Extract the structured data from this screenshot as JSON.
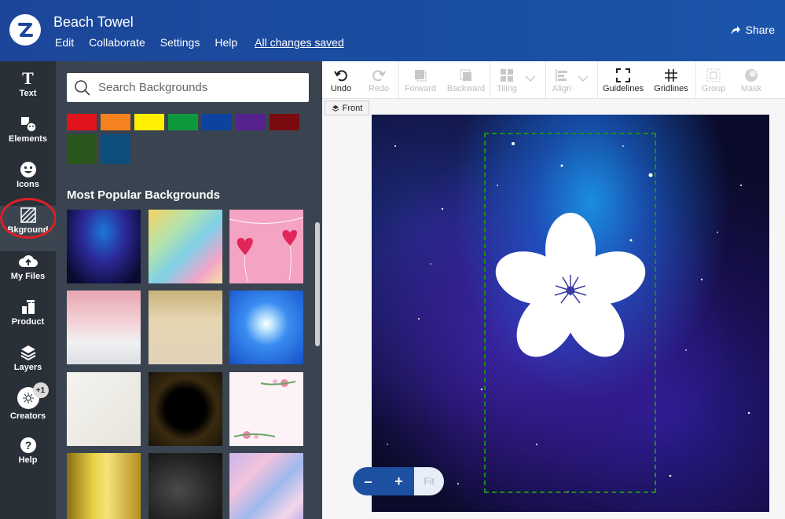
{
  "header": {
    "title": "Beach Towel",
    "menu": [
      "Edit",
      "Collaborate",
      "Settings",
      "Help"
    ],
    "saved_status": "All changes saved",
    "share_label": "Share",
    "logo_icon": "zazzle-logo-icon"
  },
  "rail": [
    {
      "label": "Text",
      "icon": "text-icon"
    },
    {
      "label": "Elements",
      "icon": "elements-icon"
    },
    {
      "label": "Icons",
      "icon": "smiley-icon"
    },
    {
      "label": "Bkground",
      "icon": "background-icon"
    },
    {
      "label": "My Files",
      "icon": "cloud-upload-icon"
    },
    {
      "label": "Product",
      "icon": "product-icon"
    },
    {
      "label": "Layers",
      "icon": "layers-icon"
    },
    {
      "label": "Creators",
      "icon": "creators-icon",
      "badge": "+1"
    },
    {
      "label": "Help",
      "icon": "help-icon"
    }
  ],
  "panel": {
    "search_placeholder": "Search Backgrounds",
    "swatch_colors": [
      "#e3131e",
      "#f5821f",
      "#ffef00",
      "#0e9a3c",
      "#0d43a0",
      "#55228e",
      "#7a0a10",
      "#2b571d",
      "#0c4e7d"
    ],
    "section_title": "Most Popular Backgrounds",
    "thumbnails": [
      "galaxy",
      "watercolor",
      "pink-hearts",
      "pink-glitter",
      "gold-drip",
      "blue-burst",
      "white-paper",
      "gold-sparkle-frame",
      "floral-frame",
      "gold-gradient",
      "black-marble",
      "pastel-swirl"
    ]
  },
  "toolbar": {
    "undo": "Undo",
    "redo": "Redo",
    "forward": "Forward",
    "backward": "Backward",
    "tiling": "Tiling",
    "align": "Align",
    "guidelines": "Guidelines",
    "gridlines": "Gridlines",
    "group": "Group",
    "mask": "Mask"
  },
  "canvas": {
    "side_label": "Front",
    "zoom_minus": "–",
    "zoom_plus": "+",
    "zoom_fit": "Fit"
  },
  "colors": {
    "header": "#1c4699",
    "rail": "#293038",
    "panel": "#3a4450",
    "highlight_ring": "#e01f26",
    "safe_area": "#1f8b1f"
  }
}
